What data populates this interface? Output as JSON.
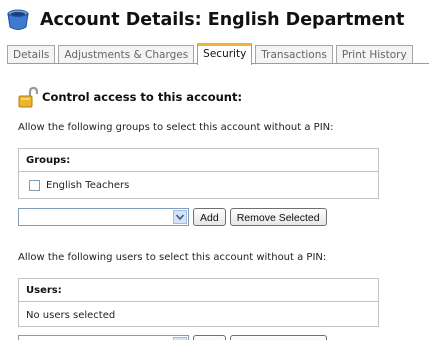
{
  "header": {
    "title": "Account Details: English Department",
    "icon": "account-cup-icon"
  },
  "tabs": [
    {
      "label": "Details",
      "active": false
    },
    {
      "label": "Adjustments & Charges",
      "active": false
    },
    {
      "label": "Security",
      "active": true
    },
    {
      "label": "Transactions",
      "active": false
    },
    {
      "label": "Print History",
      "active": false
    }
  ],
  "security": {
    "heading": "Control access to this account:",
    "heading_icon": "padlock-open-icon",
    "groups_desc": "Allow the following groups to select this account without a PIN:",
    "groups_header": "Groups:",
    "groups": [
      {
        "label": "English Teachers",
        "checked": false
      }
    ],
    "group_select_value": "",
    "add_label": "Add",
    "remove_label": "Remove Selected",
    "users_desc": "Allow the following users to select this account without a PIN:",
    "users_header": "Users:",
    "users_empty": "No users selected",
    "user_select_value": ""
  },
  "colors": {
    "active_tab_accent": "#f2b233",
    "border": "#c3c3c3"
  }
}
